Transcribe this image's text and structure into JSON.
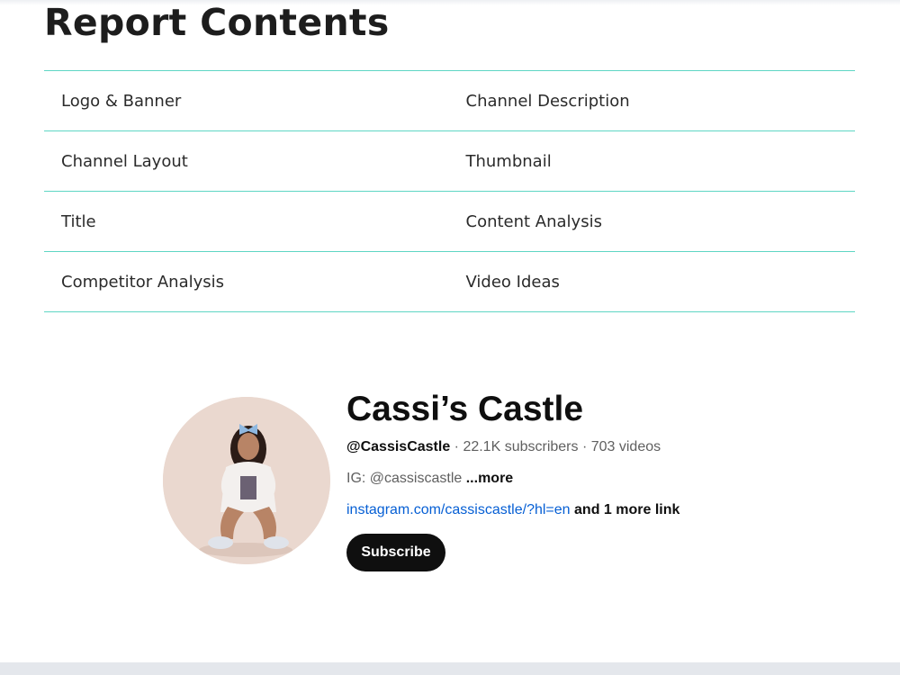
{
  "report": {
    "title": "Report Contents",
    "accent_color": "#5fd6c4",
    "rows": [
      [
        "Logo & Banner",
        "Channel Description"
      ],
      [
        "Channel Layout",
        "Thumbnail"
      ],
      [
        "Title",
        "Content Analysis"
      ],
      [
        "Competitor Analysis",
        "Video Ideas"
      ]
    ]
  },
  "channel": {
    "name": "Cassi’s Castle",
    "handle": "@CassisCastle",
    "separator": " · ",
    "subscribers": "22.1K subscribers",
    "videos": "703 videos",
    "description": "IG: @cassiscastle",
    "more_label": "...more",
    "link": "instagram.com/cassiscastle/?hl=en",
    "more_links": "and 1 more link",
    "subscribe_label": "Subscribe",
    "link_color": "#065fd4"
  }
}
